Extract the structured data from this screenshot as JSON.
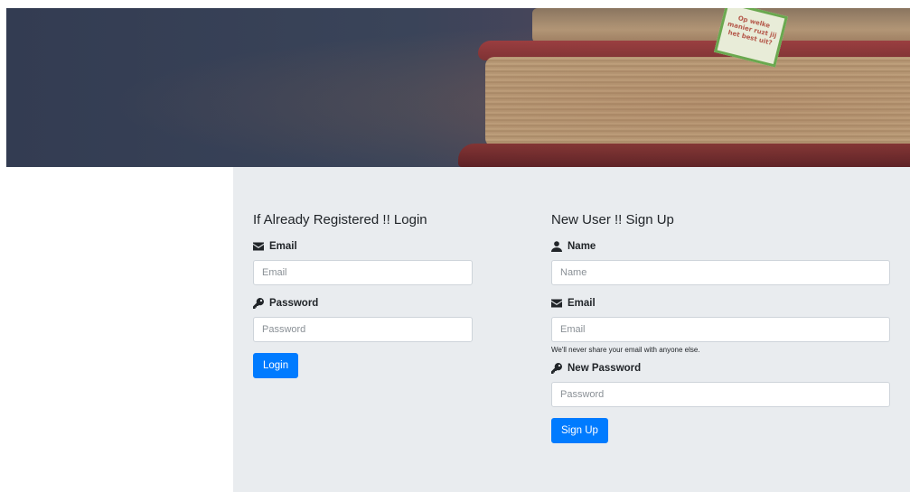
{
  "hero": {
    "note_text": "Op welke manier ruzt jij het best uit?"
  },
  "login": {
    "heading": "If Already Registered !! Login",
    "email_label": "Email",
    "email_placeholder": "Email",
    "password_label": "Password",
    "password_placeholder": "Password",
    "button_label": "Login"
  },
  "signup": {
    "heading": "New User !! Sign Up",
    "name_label": "Name",
    "name_placeholder": "Name",
    "email_label": "Email",
    "email_placeholder": "Email",
    "email_help": "We'll never share your email with anyone else.",
    "password_label": "New Password",
    "password_placeholder": "Password",
    "button_label": "Sign Up"
  },
  "icons": {
    "email": "envelope-icon",
    "password": "key-icon",
    "name": "user-icon"
  },
  "colors": {
    "primary": "#007bff",
    "panel_bg": "#e9ecef"
  }
}
